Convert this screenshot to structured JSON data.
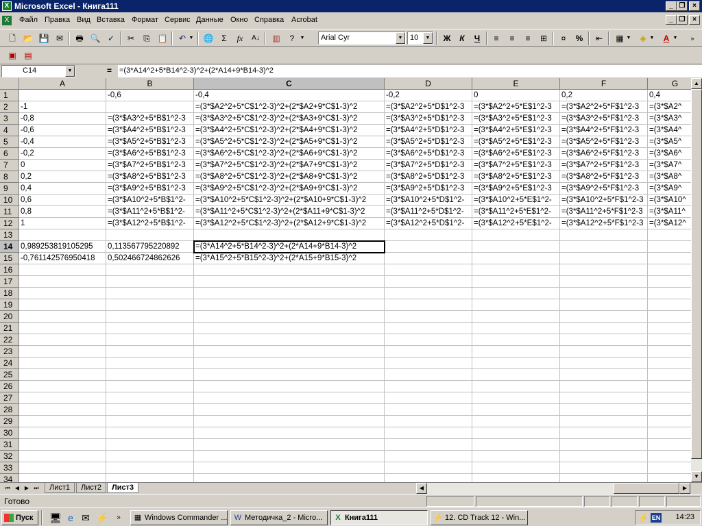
{
  "app": {
    "title": "Microsoft Excel - Книга111"
  },
  "menu": [
    "Файл",
    "Правка",
    "Вид",
    "Вставка",
    "Формат",
    "Сервис",
    "Данные",
    "Окно",
    "Справка",
    "Acrobat"
  ],
  "toolbar": {
    "font_name": "Arial Cyr",
    "font_size": "10",
    "bold_label": "Ж",
    "italic_label": "К",
    "underline_label": "Ч",
    "percent_label": "%",
    "sum_label": "Σ",
    "fx_label": "fx"
  },
  "formula_bar": {
    "name_box": "C14",
    "equals": "=",
    "formula": "=(3*A14^2+5*B14^2-3)^2+(2*A14+9*B14-3)^2"
  },
  "columns": [
    "A",
    "B",
    "C",
    "D",
    "E",
    "F",
    "G"
  ],
  "rows": [
    "1",
    "2",
    "3",
    "4",
    "5",
    "6",
    "7",
    "8",
    "9",
    "10",
    "11",
    "12",
    "13",
    "14",
    "15",
    "16",
    "17",
    "18",
    "19",
    "20",
    "21",
    "22",
    "23",
    "24",
    "25",
    "26",
    "27",
    "28",
    "29",
    "30",
    "31",
    "32",
    "33",
    "34"
  ],
  "cells": [
    [
      "",
      "-0,6",
      "-0,4",
      "-0,2",
      "0",
      "0,2",
      "0,4"
    ],
    [
      "-1",
      "",
      "=(3*$A2^2+5*C$1^2-3)^2+(2*$A2+9*C$1-3)^2",
      "=(3*$A2^2+5*D$1^2-3",
      "=(3*$A2^2+5*E$1^2-3",
      "=(3*$A2^2+5*F$1^2-3",
      "=(3*$A2^"
    ],
    [
      "-0,8",
      "=(3*$A3^2+5*B$1^2-3",
      "=(3*$A3^2+5*C$1^2-3)^2+(2*$A3+9*C$1-3)^2",
      "=(3*$A3^2+5*D$1^2-3",
      "=(3*$A3^2+5*E$1^2-3",
      "=(3*$A3^2+5*F$1^2-3",
      "=(3*$A3^"
    ],
    [
      "-0,6",
      "=(3*$A4^2+5*B$1^2-3",
      "=(3*$A4^2+5*C$1^2-3)^2+(2*$A4+9*C$1-3)^2",
      "=(3*$A4^2+5*D$1^2-3",
      "=(3*$A4^2+5*E$1^2-3",
      "=(3*$A4^2+5*F$1^2-3",
      "=(3*$A4^"
    ],
    [
      "-0,4",
      "=(3*$A5^2+5*B$1^2-3",
      "=(3*$A5^2+5*C$1^2-3)^2+(2*$A5+9*C$1-3)^2",
      "=(3*$A5^2+5*D$1^2-3",
      "=(3*$A5^2+5*E$1^2-3",
      "=(3*$A5^2+5*F$1^2-3",
      "=(3*$A5^"
    ],
    [
      "-0,2",
      "=(3*$A6^2+5*B$1^2-3",
      "=(3*$A6^2+5*C$1^2-3)^2+(2*$A6+9*C$1-3)^2",
      "=(3*$A6^2+5*D$1^2-3",
      "=(3*$A6^2+5*E$1^2-3",
      "=(3*$A6^2+5*F$1^2-3",
      "=(3*$A6^"
    ],
    [
      "0",
      "=(3*$A7^2+5*B$1^2-3",
      "=(3*$A7^2+5*C$1^2-3)^2+(2*$A7+9*C$1-3)^2",
      "=(3*$A7^2+5*D$1^2-3",
      "=(3*$A7^2+5*E$1^2-3",
      "=(3*$A7^2+5*F$1^2-3",
      "=(3*$A7^"
    ],
    [
      "0,2",
      "=(3*$A8^2+5*B$1^2-3",
      "=(3*$A8^2+5*C$1^2-3)^2+(2*$A8+9*C$1-3)^2",
      "=(3*$A8^2+5*D$1^2-3",
      "=(3*$A8^2+5*E$1^2-3",
      "=(3*$A8^2+5*F$1^2-3",
      "=(3*$A8^"
    ],
    [
      "0,4",
      "=(3*$A9^2+5*B$1^2-3",
      "=(3*$A9^2+5*C$1^2-3)^2+(2*$A9+9*C$1-3)^2",
      "=(3*$A9^2+5*D$1^2-3",
      "=(3*$A9^2+5*E$1^2-3",
      "=(3*$A9^2+5*F$1^2-3",
      "=(3*$A9^"
    ],
    [
      "0,6",
      "=(3*$A10^2+5*B$1^2-",
      "=(3*$A10^2+5*C$1^2-3)^2+(2*$A10+9*C$1-3)^2",
      "=(3*$A10^2+5*D$1^2-",
      "=(3*$A10^2+5*E$1^2-",
      "=(3*$A10^2+5*F$1^2-3",
      "=(3*$A10^"
    ],
    [
      "0,8",
      "=(3*$A11^2+5*B$1^2-",
      "=(3*$A11^2+5*C$1^2-3)^2+(2*$A11+9*C$1-3)^2",
      "=(3*$A11^2+5*D$1^2-",
      "=(3*$A11^2+5*E$1^2-",
      "=(3*$A11^2+5*F$1^2-3",
      "=(3*$A11^"
    ],
    [
      "1",
      "=(3*$A12^2+5*B$1^2-",
      "=(3*$A12^2+5*C$1^2-3)^2+(2*$A12+9*C$1-3)^2",
      "=(3*$A12^2+5*D$1^2-",
      "=(3*$A12^2+5*E$1^2-",
      "=(3*$A12^2+5*F$1^2-3",
      "=(3*$A12^"
    ],
    [
      "",
      "",
      "",
      "",
      "",
      "",
      ""
    ],
    [
      "0,989253819105295",
      "0,113567795220892",
      "=(3*A14^2+5*B14^2-3)^2+(2*A14+9*B14-3)^2",
      "",
      "",
      "",
      ""
    ],
    [
      "-0,761142576950418",
      "0,502466724862626",
      "=(3*A15^2+5*B15^2-3)^2+(2*A15+9*B15-3)^2",
      "",
      "",
      "",
      ""
    ]
  ],
  "sheets": [
    "Лист1",
    "Лист2",
    "Лист3"
  ],
  "active_sheet": "Лист3",
  "status": "Готово",
  "taskbar": {
    "start": "Пуск",
    "tasks": [
      "Windows Commander ...",
      "Методичка_2 - Micro...",
      "Книга111",
      "12. CD Track 12 - Win..."
    ],
    "lang": "EN",
    "clock": "14:23"
  }
}
